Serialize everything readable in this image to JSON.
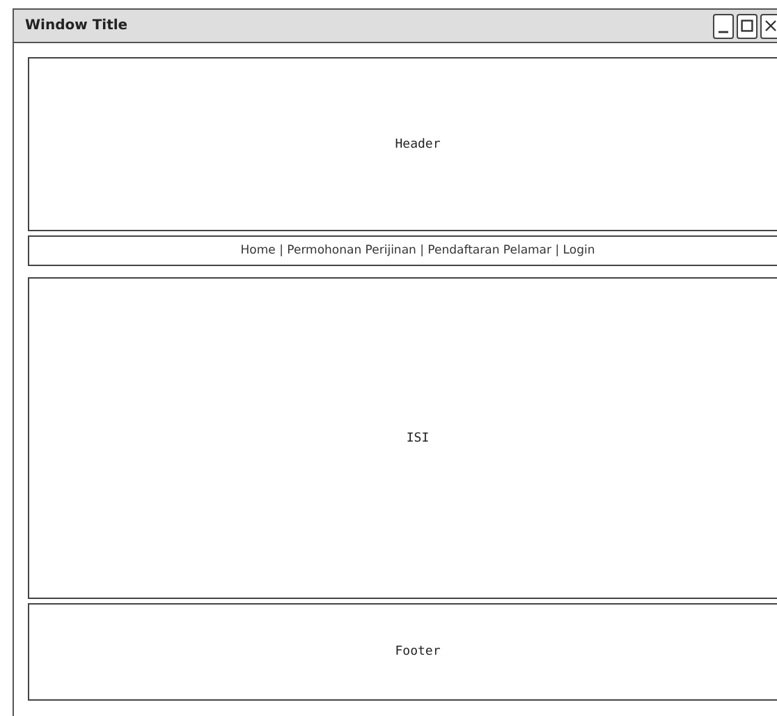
{
  "window": {
    "title": "Window Title"
  },
  "header": {
    "label": "Header"
  },
  "navigation": {
    "text": "Home | Permohonan Perijinan | Pendaftaran Pelamar | Login"
  },
  "content": {
    "label": "ISI"
  },
  "footer": {
    "label": "Footer"
  }
}
